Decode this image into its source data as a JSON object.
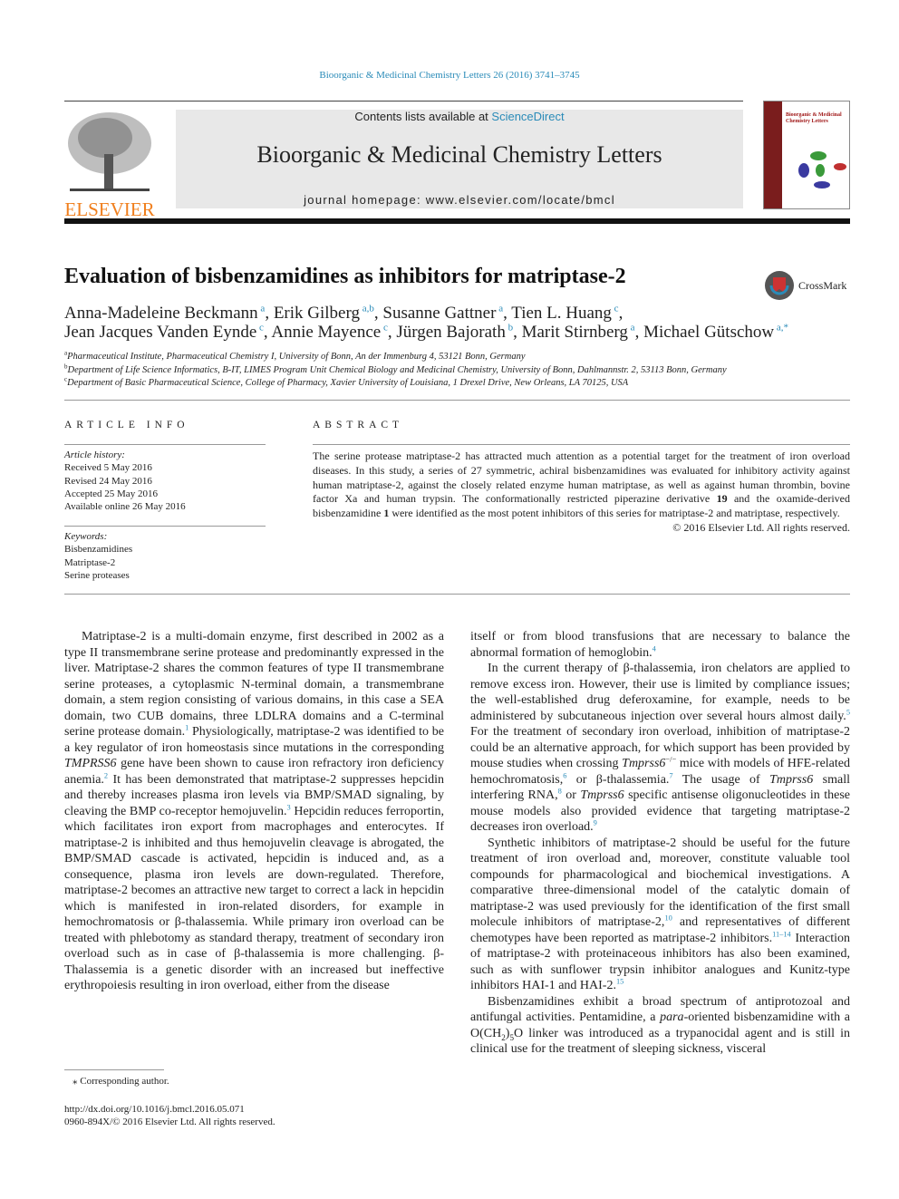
{
  "header": {
    "journal_ref": "Bioorganic & Medicinal Chemistry Letters 26 (2016) 3741–3745",
    "contents_prefix": "Contents lists available at ",
    "contents_link": "ScienceDirect",
    "journal_title": "Bioorganic & Medicinal Chemistry Letters",
    "homepage": "journal homepage: www.elsevier.com/locate/bmcl",
    "publisher": "ELSEVIER",
    "cover_title": "Bioorganic & Medicinal Chemistry Letters",
    "colors": {
      "link": "#2a8bb8",
      "elsevier": "#f07f1d",
      "banner": "#e8e8e8",
      "cover_spine": "#7a1d1d"
    }
  },
  "article": {
    "title": "Evaluation of bisbenzamidines as inhibitors for matriptase-2",
    "crossmark": "CrossMark",
    "authors_line1": [
      [
        "Anna-Madeleine Beckmann",
        "a"
      ],
      [
        "Erik Gilberg",
        "a,b"
      ],
      [
        "Susanne Gattner",
        "a"
      ],
      [
        "Tien L. Huang",
        "c"
      ]
    ],
    "authors_line2": [
      [
        "Jean Jacques Vanden Eynde",
        "c"
      ],
      [
        "Annie Mayence",
        "c"
      ],
      [
        "Jürgen Bajorath",
        "b"
      ],
      [
        "Marit Stirnberg",
        "a"
      ],
      [
        "Michael Gütschow",
        "a,*"
      ]
    ],
    "affiliations": [
      [
        "a",
        "Pharmaceutical Institute, Pharmaceutical Chemistry I, University of Bonn, An der Immenburg 4, 53121 Bonn, Germany"
      ],
      [
        "b",
        "Department of Life Science Informatics, B-IT, LIMES Program Unit Chemical Biology and Medicinal Chemistry, University of Bonn, Dahlmannstr. 2, 53113 Bonn, Germany"
      ],
      [
        "c",
        "Department of Basic Pharmaceutical Science, College of Pharmacy, Xavier University of Louisiana, 1 Drexel Drive, New Orleans, LA 70125, USA"
      ]
    ]
  },
  "info": {
    "heading": "ARTICLE INFO",
    "history_label": "Article history:",
    "history": [
      "Received 5 May 2016",
      "Revised 24 May 2016",
      "Accepted 25 May 2016",
      "Available online 26 May 2016"
    ],
    "keywords_label": "Keywords:",
    "keywords": [
      "Bisbenzamidines",
      "Matriptase-2",
      "Serine proteases"
    ]
  },
  "abstract": {
    "heading": "ABSTRACT",
    "segments": [
      "The serine protease matriptase-2 has attracted much attention as a potential target for the treatment of iron overload diseases. In this study, a series of 27 symmetric, achiral bisbenzamidines was evaluated for inhibitory activity against human matriptase-2, against the closely related enzyme human matriptase, as well as against human thrombin, bovine factor Xa and human trypsin. The conformationally restricted piperazine derivative ",
      [
        "b",
        "19"
      ],
      " and the oxamide-derived bisbenzamidine ",
      [
        "b",
        "1"
      ],
      " were identified as the most potent inhibitors of this series for matriptase-2 and matriptase, respectively."
    ],
    "copyright": "© 2016 Elsevier Ltd. All rights reserved."
  },
  "body_left": [
    {
      "indent": true,
      "segments": [
        "Matriptase-2 is a multi-domain enzyme, first described in 2002 as a type II transmembrane serine protease and predominantly expressed in the liver. Matriptase-2 shares the common features of type II transmembrane serine proteases, a cytoplasmic N-terminal domain, a transmembrane domain, a stem region consisting of various domains, in this case a SEA domain, two CUB domains, three LDLRA domains and a C-terminal serine protease domain.",
        [
          "ref",
          "1"
        ],
        " Physiologically, matriptase-2 was identified to be a key regulator of iron homeostasis since mutations in the corresponding ",
        [
          "i",
          "TMPRSS6"
        ],
        " gene have been shown to cause iron refractory iron deficiency anemia.",
        [
          "ref",
          "2"
        ],
        " It has been demonstrated that matriptase-2 suppresses hepcidin and thereby increases plasma iron levels via BMP/SMAD signaling, by cleaving the BMP co-receptor hemojuvelin.",
        [
          "ref",
          "3"
        ],
        " Hepcidin reduces ferroportin, which facilitates iron export from macrophages and enterocytes. If matriptase-2 is inhibited and thus hemojuvelin cleavage is abrogated, the BMP/SMAD cascade is activated, hepcidin is induced and, as a consequence, plasma iron levels are down-regulated. Therefore, matriptase-2 becomes an attractive new target to correct a lack in hepcidin which is manifested in iron-related disorders, for example in hemochromatosis or β-thalassemia. While primary iron overload can be treated with phlebotomy as standard therapy, treatment of secondary iron overload such as in case of β-thalassemia is more challenging. β-Thalassemia is a genetic disorder with an increased but ineffective erythropoiesis resulting in iron overload, either from the disease"
      ]
    }
  ],
  "body_right": [
    {
      "indent": false,
      "segments": [
        "itself or from blood transfusions that are necessary to balance the abnormal formation of hemoglobin.",
        [
          "ref",
          "4"
        ]
      ]
    },
    {
      "indent": true,
      "segments": [
        "In the current therapy of β-thalassemia, iron chelators are applied to remove excess iron. However, their use is limited by compliance issues; the well-established drug deferoxamine, for example, needs to be administered by subcutaneous injection over several hours almost daily.",
        [
          "ref",
          "5"
        ],
        " For the treatment of secondary iron overload, inhibition of matriptase-2 could be an alternative approach, for which support has been provided by mouse studies when crossing ",
        [
          "i",
          "Tmprss6"
        ],
        [
          "sup",
          "−/−"
        ],
        " mice with models of HFE-related hemochromatosis,",
        [
          "ref",
          "6"
        ],
        " or β-thalassemia.",
        [
          "ref",
          "7"
        ],
        " The usage of ",
        [
          "i",
          "Tmprss6"
        ],
        " small interfering RNA,",
        [
          "ref",
          "8"
        ],
        " or ",
        [
          "i",
          "Tmprss6"
        ],
        " specific antisense oligonucleotides in these mouse models also provided evidence that targeting matriptase-2 decreases iron overload.",
        [
          "ref",
          "9"
        ]
      ]
    },
    {
      "indent": true,
      "segments": [
        "Synthetic inhibitors of matriptase-2 should be useful for the future treatment of iron overload and, moreover, constitute valuable tool compounds for pharmacological and biochemical investigations. A comparative three-dimensional model of the catalytic domain of matriptase-2 was used previously for the identification of the first small molecule inhibitors of matriptase-2,",
        [
          "ref",
          "10"
        ],
        " and representatives of different chemotypes have been reported as matriptase-2 inhibitors.",
        [
          "ref",
          "11–14"
        ],
        " Interaction of matriptase-2 with proteinaceous inhibitors has also been examined, such as with sunflower trypsin inhibitor analogues and Kunitz-type inhibitors HAI-1 and HAI-2.",
        [
          "ref",
          "15"
        ]
      ]
    },
    {
      "indent": true,
      "segments": [
        "Bisbenzamidines exhibit a broad spectrum of antiprotozoal and antifungal activities. Pentamidine, a ",
        [
          "i",
          "para"
        ],
        "-oriented bisbenzamidine with a O(CH",
        [
          "sub",
          "2"
        ],
        ")",
        [
          "sub",
          "5"
        ],
        "O linker was introduced as a trypanocidal agent and is still in clinical use for the treatment of sleeping sickness, visceral"
      ]
    }
  ],
  "footer": {
    "corresponding": "⁎ Corresponding author.",
    "doi": "http://dx.doi.org/10.1016/j.bmcl.2016.05.071",
    "issn": "0960-894X/© 2016 Elsevier Ltd. All rights reserved."
  }
}
